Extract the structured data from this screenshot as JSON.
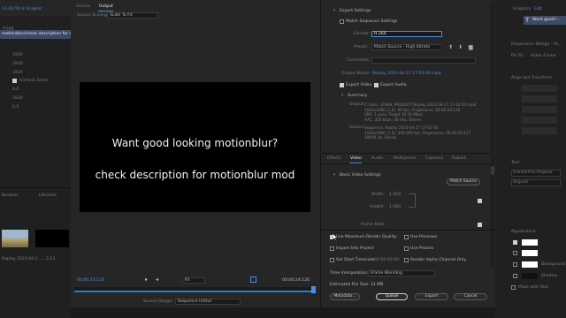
{
  "left_panel": {
    "title": "17-02-50 ≡ Graphic",
    "row": "rd.jpg",
    "clip_name": "motionblur/check description for motionblur mo",
    "props": [
      "1920",
      "1920",
      "1920",
      "Uniform Scale",
      "0.0",
      "1920",
      "0.0"
    ],
    "bin_tabs": [
      "Browser",
      "Libraries"
    ],
    "thumb_captions": [
      "14:00",
      "Replay 2023-04-2 …",
      "2:13"
    ]
  },
  "source_panel": {
    "tabs": [
      "Source",
      "Output"
    ],
    "scaling_label": "Source Scaling:",
    "scaling_value": "Scale To Fit",
    "preview_lines": [
      "Want good looking motionblur?",
      "check description for motionblur mod"
    ],
    "timecode_in": "00:00:24:124",
    "timecode_out": "00:00:24:126",
    "fit_value": "Fit",
    "source_range_label": "Source Range:",
    "source_range_value": "Sequence In/Out"
  },
  "export_settings": {
    "header": "Export Settings",
    "match_sequence": "Match Sequence Settings",
    "format_label": "Format:",
    "format_value": "H.264",
    "preset_label": "Preset:",
    "preset_value": "Match Source - High bitrate",
    "comments_label": "Comments:",
    "output_label": "Output Name:",
    "output_value": "Replay 2023-04-27 17-02-50.mp4",
    "export_video": "Export Video",
    "export_audio": "Export Audio",
    "summary_header": "Summary",
    "output_summary_label": "Output:",
    "output_summary": [
      "C:\\User...\\FINAL PRODUCT\\Replay 2023-04-27 17-02-50.mp4",
      "1920x1080 (1.0), 60 fps, Progressive, 00:00:24:126",
      "VBR, 1 pass, Target 10.00 Mbps",
      "AAC, 320 kbps, 48 kHz, Stereo"
    ],
    "source_summary_label": "Source:",
    "source_summary": [
      "Sequence, Replay 2023-04-27 17-02-50",
      "1920x1080 (1.0), 240.004 fps, Progressive, 00:00:24:127",
      "48000 Hz, Stereo"
    ]
  },
  "tabs": [
    "Effects",
    "Video",
    "Audio",
    "Multiplexer",
    "Captions",
    "Publish"
  ],
  "video": {
    "section": "Basic Video Settings",
    "match_source": "Match Source",
    "width_label": "Width:",
    "width_value": "1,920",
    "height_label": "Height:",
    "height_value": "1,080",
    "frame_rate_label": "Frame Rate:"
  },
  "options": {
    "max_render": "Use Maximum Render Quality",
    "use_previews": "Use Previews",
    "import_project": "Import Into Project",
    "use_proxies": "Use Proxies",
    "start_timecode": "Set Start Timecode",
    "start_timecode_value": "00:00:00:00",
    "render_alpha": "Render Alpha Channel Only",
    "interp_label": "Time Interpolation:",
    "interp_value": "Frame Blending",
    "file_size_label": "Estimated File Size:",
    "file_size_value": "31 MB"
  },
  "buttons": {
    "metadata": "Metadata...",
    "queue": "Queue",
    "export": "Export",
    "cancel": "Cancel"
  },
  "right_panel": {
    "tabs": [
      "Graphics",
      "Edit"
    ],
    "layer": "Want good l…",
    "responsive": "Responsive Design - Po…",
    "pin_to": "Pin To:",
    "pin_value": "Video Frame",
    "align": "Align and Transform",
    "text_section": "Text",
    "font_value": "FrankenPro-Regular",
    "font_style": "Regular",
    "appearance": "Appearance",
    "fill": "Fill",
    "stroke": "Stroke",
    "background": "Background",
    "shadow": "Shadow",
    "mask": "Mask with Text"
  },
  "colors": {
    "accent": "#4b8fe0",
    "preview_bg": "#000000",
    "panel": "#262626",
    "timebar": "#2e7fd6"
  }
}
